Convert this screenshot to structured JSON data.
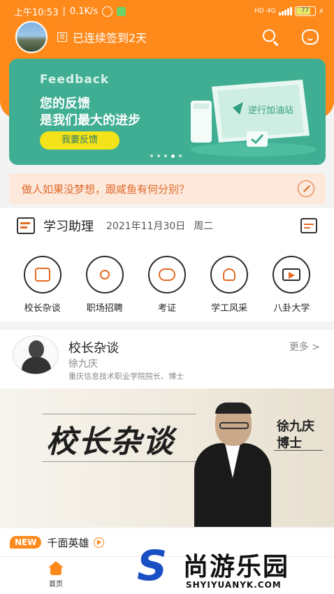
{
  "status_bar": {
    "time": "上午10:53",
    "speed": "0.1K/s",
    "network": "4G",
    "hd": "HD",
    "battery": "77"
  },
  "header": {
    "sign_badge": "签",
    "sign_text": "已连续签到2天"
  },
  "banner": {
    "title_en": "Feedback",
    "line1": "您的反馈",
    "line2": "是我们最大的进步",
    "button_label": "我要反馈",
    "illustration_text": "逆行加油站",
    "slide_count": 5,
    "active_slide": 4
  },
  "quote": {
    "text": "做人如果没梦想，跟咸鱼有何分别？"
  },
  "assistant": {
    "title": "学习助理",
    "date": "2021年11月30日",
    "weekday": "周二",
    "items": [
      {
        "label": "校长杂谈",
        "icon": "chat-icon"
      },
      {
        "label": "职场招聘",
        "icon": "runner-icon"
      },
      {
        "label": "考证",
        "icon": "certificate-icon"
      },
      {
        "label": "学工风采",
        "icon": "hero-icon"
      },
      {
        "label": "八卦大学",
        "icon": "video-icon"
      }
    ]
  },
  "president": {
    "section_title": "校长杂谈",
    "more_label": "更多 >",
    "person_name": "徐九庆",
    "description": "重庆信息技术职业学院院长、博士"
  },
  "poster": {
    "headline": "校长杂谈",
    "name": "徐九庆",
    "degree": "博士"
  },
  "new_item": {
    "badge": "NEW",
    "title": "千面英雄"
  },
  "tabbar": {
    "home_label": "首页"
  },
  "watermark": {
    "logo_letter": "S",
    "cn": "尚游乐园",
    "en": "SHYIYUANYK.COM"
  },
  "colors": {
    "brand_orange": "#ff8a1c",
    "banner_green": "#3fae92",
    "quote_bg": "#fde8dc",
    "quote_text": "#e06a2a"
  }
}
